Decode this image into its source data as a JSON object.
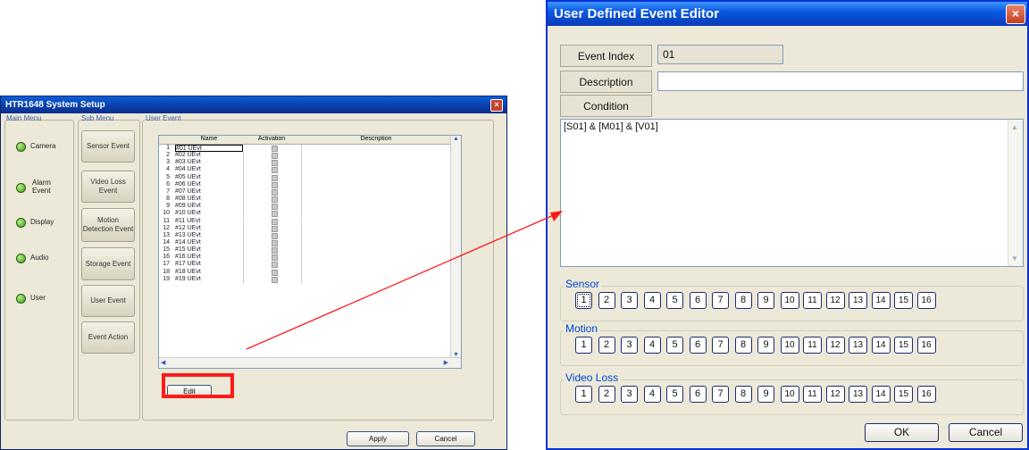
{
  "left_window": {
    "title": "HTR1648 System Setup",
    "close_glyph": "×",
    "main_menu_label": "Main Menu",
    "sub_menu_label": "Sub Menu",
    "user_event_label": "User Event",
    "main_items": [
      {
        "label": "Camera"
      },
      {
        "label": "Alarm Event"
      },
      {
        "label": "Display"
      },
      {
        "label": "Audio"
      },
      {
        "label": "User"
      }
    ],
    "sub_items": [
      {
        "label": "Sensor Event"
      },
      {
        "label": "Video Loss Event"
      },
      {
        "label": "Motion Detection Event"
      },
      {
        "label": "Storage Event"
      },
      {
        "label": "User Event"
      },
      {
        "label": "Event Action"
      }
    ],
    "table": {
      "headers": {
        "name": "Name",
        "activation": "Activation",
        "description": "Description"
      },
      "rows": [
        {
          "num": "1",
          "name": "#01 UEvt"
        },
        {
          "num": "2",
          "name": "#02 UEvt"
        },
        {
          "num": "3",
          "name": "#03 UEvt"
        },
        {
          "num": "4",
          "name": "#04 UEvt"
        },
        {
          "num": "5",
          "name": "#05 UEvt"
        },
        {
          "num": "6",
          "name": "#06 UEvt"
        },
        {
          "num": "7",
          "name": "#07 UEvt"
        },
        {
          "num": "8",
          "name": "#08 UEvt"
        },
        {
          "num": "9",
          "name": "#09 UEvt"
        },
        {
          "num": "10",
          "name": "#10 UEvt"
        },
        {
          "num": "11",
          "name": "#11 UEvt"
        },
        {
          "num": "12",
          "name": "#12 UEvt"
        },
        {
          "num": "13",
          "name": "#13 UEvt"
        },
        {
          "num": "14",
          "name": "#14 UEvt"
        },
        {
          "num": "15",
          "name": "#15 UEvt"
        },
        {
          "num": "16",
          "name": "#16 UEvt"
        },
        {
          "num": "17",
          "name": "#17 UEvt"
        },
        {
          "num": "18",
          "name": "#18 UEvt"
        },
        {
          "num": "19",
          "name": "#19 UEvt"
        }
      ]
    },
    "edit_label": "Edit",
    "apply_label": "Apply",
    "cancel_label": "Cancel"
  },
  "right_window": {
    "title": "User Defined Event Editor",
    "close_glyph": "×",
    "event_index_label": "Event Index",
    "event_index_value": "01",
    "description_label": "Description",
    "description_value": "",
    "condition_label": "Condition",
    "condition_text": "[S01] & [M01] & [V01]",
    "sections": [
      {
        "label": "Sensor",
        "buttons": [
          "1",
          "2",
          "3",
          "4",
          "5",
          "6",
          "7",
          "8",
          "9",
          "10",
          "11",
          "12",
          "13",
          "14",
          "15",
          "16"
        ]
      },
      {
        "label": "Motion",
        "buttons": [
          "1",
          "2",
          "3",
          "4",
          "5",
          "6",
          "7",
          "8",
          "9",
          "10",
          "11",
          "12",
          "13",
          "14",
          "15",
          "16"
        ]
      },
      {
        "label": "Video Loss",
        "buttons": [
          "1",
          "2",
          "3",
          "4",
          "5",
          "6",
          "7",
          "8",
          "9",
          "10",
          "11",
          "12",
          "13",
          "14",
          "15",
          "16"
        ]
      }
    ],
    "ok_label": "OK",
    "cancel_label": "Cancel"
  },
  "annotation": {
    "color": "#ff1a1a"
  }
}
